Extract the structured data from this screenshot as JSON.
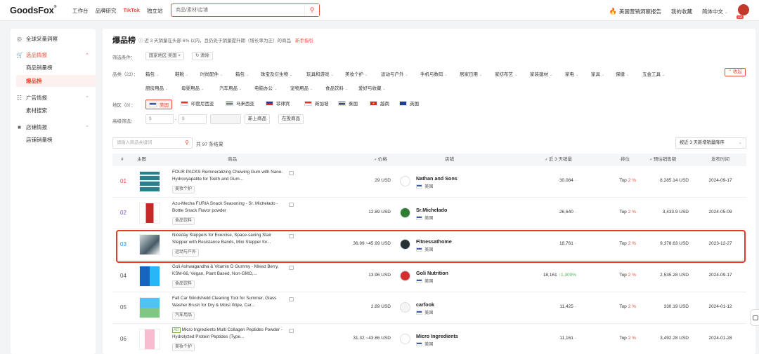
{
  "header": {
    "logo": "GoodsFox",
    "nav": [
      "工作台",
      "品牌研究",
      "TikTok",
      "独立站"
    ],
    "search_placeholder": "商品/素材/店铺",
    "right": [
      "美国营销洞察报告",
      "我的收藏",
      "简体中文"
    ],
    "vip": "VIP"
  },
  "sidebar": {
    "overview": "全球采量洞察",
    "sections": [
      {
        "label": "选品情报",
        "items": [
          "商品销量榜",
          "爆品榜"
        ]
      },
      {
        "label": "广告情报",
        "items": [
          "素材搜索"
        ]
      },
      {
        "label": "店铺情报",
        "items": [
          "店铺销量榜"
        ]
      }
    ]
  },
  "page": {
    "title": "爆品榜",
    "subtitle": "近 3 天销量在头部 6% 以内，且仍处于销量提升期（增长率为正）的商品",
    "guide_link": "新手指引",
    "filter_label": "筛选条件：",
    "filter_chip": "国家地区:美国",
    "clear": "清除",
    "category_label": "品类（23）：",
    "categories_row1": [
      "箱包",
      "鞋靴",
      "时尚配件",
      "箱包",
      "珠宝及衍生物",
      "玩具和游戏",
      "美妆个护",
      "运动与户外",
      "手机与数码",
      "居家日用",
      "家纺布艺",
      "家装建材",
      "家电",
      "家具",
      "保健",
      "五金工具"
    ],
    "categories_row2": [
      "厨房用品",
      "母婴用品",
      "汽车用品",
      "电脑办公",
      "宠物用品",
      "食品饮料",
      "爱好与收藏"
    ],
    "collapse": "收起",
    "region_label": "地区（8）：",
    "regions": [
      "美国",
      "印度尼西亚",
      "马来西亚",
      "菲律宾",
      "新加坡",
      "泰国",
      "越南",
      "英国"
    ],
    "advanced_label": "高级筛选：",
    "price_from": "$",
    "price_to": "$",
    "new_product": "新上商品",
    "selling_product": "在投商品",
    "product_search_placeholder": "请输入商品关键词",
    "result_count": "共 97 条结果",
    "sort": "按近 3 天新增销量降序"
  },
  "table": {
    "headers": {
      "rank": "#",
      "image": "主图",
      "product": "商品",
      "price": "价格",
      "shop": "店铺",
      "sales": "近 3 天销量",
      "ranking": "排位",
      "gmv": "预估销售额",
      "date": "发布时间"
    },
    "rows": [
      {
        "rank": "01",
        "ad": "",
        "name": "FOUR PACKS Remineralizing Chewing Gum with Nano-Hydroxyapatite for Teeth and Gum...",
        "tag": "美妆个护",
        "price": "29 USD",
        "shop": "Nathan and Sons",
        "country": "美国",
        "sales": "30,084",
        "growth": "",
        "top": "Top",
        "pct": "2 %",
        "gmv": "8,285.14 USD",
        "date": "2024-09-17"
      },
      {
        "rank": "02",
        "ad": "",
        "name": "Azu-Mecha FURIA Snack Seasoning - Sr. Michelado - Bottle Snack Flavor powder",
        "tag": "食品饮料",
        "price": "12.89 USD",
        "shop": "Sr.Michelado",
        "country": "美国",
        "sales": "26,640",
        "growth": "",
        "top": "Top",
        "pct": "2 %",
        "gmv": "3,433.9 USD",
        "date": "2024-05-09"
      },
      {
        "rank": "03",
        "ad": "",
        "name": "Niceday Steppers for Exercise, Space-saving Stair Stepper with Resistance Bands, Mini Stepper for...",
        "tag": "运动与户外",
        "price": "36.99 ~45.99 USD",
        "shop": "Fitnessathome",
        "country": "美国",
        "sales": "18,761",
        "growth": "",
        "top": "Top",
        "pct": "2 %",
        "gmv": "9,378.63 USD",
        "date": "2023-12-27"
      },
      {
        "rank": "04",
        "ad": "",
        "name": "Goli Ashwagandha & Vitamin D Gummy - Mixed Berry, KSM-66, Vegan, Plant Based, Non-GMO,...",
        "tag": "食品饮料",
        "price": "13.96 USD",
        "shop": "Goli Nutrition",
        "country": "美国",
        "sales": "18,161",
        "growth": "1,300%",
        "top": "Top",
        "pct": "2 %",
        "gmv": "2,535.28 USD",
        "date": "2024-09-17"
      },
      {
        "rank": "05",
        "ad": "",
        "name": "Fall Car Windshield Cleaning Tool for Summer, Glass Washer Brush for Dry & Moist Wipe, Car...",
        "tag": "汽车用品",
        "price": "2.89 USD",
        "shop": "carfook",
        "country": "美国",
        "sales": "11,425",
        "growth": "",
        "top": "Top",
        "pct": "2 %",
        "gmv": "330.19 USD",
        "date": "2024-01-12"
      },
      {
        "rank": "06",
        "ad": "AD",
        "name": "Micro Ingredients Multi Collagen Peptides Powder - Hydrolyzed Protein Peptides (Type...",
        "tag": "美妆个护",
        "price": "31.32 ~43.86 USD",
        "shop": "Micro Ingredients",
        "country": "美国",
        "sales": "11,161",
        "growth": "",
        "top": "Top",
        "pct": "2 %",
        "gmv": "3,492.28 USD",
        "date": "2024-01-28"
      }
    ]
  },
  "colors": {
    "accent": "#e94e3c",
    "highlight": "#e23b2e",
    "growth": "#4caf50"
  }
}
